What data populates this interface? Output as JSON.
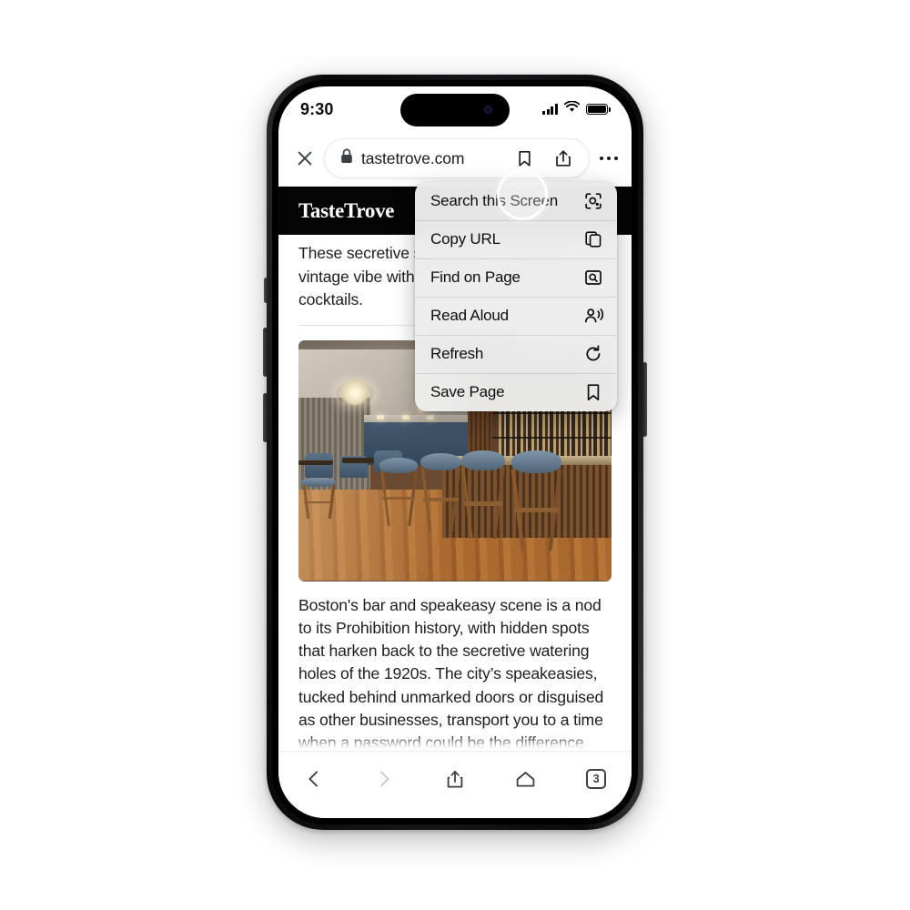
{
  "status_bar": {
    "time": "9:30",
    "icons": [
      "cellular-signal-icon",
      "wifi-icon",
      "battery-icon"
    ]
  },
  "browser": {
    "close_icon": "close-icon",
    "url": "tastetrove.com",
    "lock_icon": "lock-icon",
    "bookmark_icon": "bookmark-icon",
    "share_icon": "share-icon",
    "overflow_icon": "more-options-icon"
  },
  "context_menu": {
    "items": [
      {
        "label": "Search this Screen",
        "icon": "lens-search-icon"
      },
      {
        "label": "Copy URL",
        "icon": "copy-icon"
      },
      {
        "label": "Find on Page",
        "icon": "find-in-page-icon"
      },
      {
        "label": "Read Aloud",
        "icon": "read-aloud-icon"
      },
      {
        "label": "Refresh",
        "icon": "refresh-icon"
      },
      {
        "label": "Save Page",
        "icon": "bookmark-icon"
      }
    ]
  },
  "page": {
    "site_title": "TasteTrove",
    "teaser": "These secretive spots offer a nostalgic, vintage vibe with live jazz music, and craft cocktails.",
    "hero_image_alt": "Dimly lit speakeasy bar interior with wooden floor, blue bar stools and a chandelier",
    "body": "Boston's bar and speakeasy scene is a nod to its Prohibition history, with hidden spots that harken back to the secretive watering holes of the 1920s. The city’s speakeasies, tucked behind unmarked doors or disguised as other businesses, transport you to a time when a password could be the difference"
  },
  "bottom_bar": {
    "back_icon": "back-arrow-icon",
    "forward_icon": "forward-arrow-icon",
    "share_icon": "share-icon",
    "home_icon": "home-icon",
    "tab_count": "3"
  },
  "colors": {
    "header_black": "#050505",
    "menu_gray": "#ececec",
    "text_dark": "#1d1d1f",
    "toolbar_icon": "#3c4043"
  }
}
